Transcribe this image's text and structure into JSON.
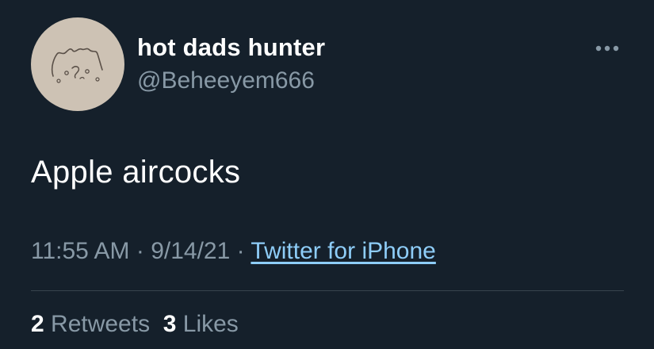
{
  "author": {
    "display_name": "hot dads hunter",
    "handle": "@Beheeyem666",
    "avatar_icon": "doodle-face-avatar"
  },
  "more_icon": "more-horizontal-icon",
  "tweet": {
    "text": "Apple aircocks",
    "time": "11:55 AM",
    "sep1": " · ",
    "date": "9/14/21",
    "sep2": " · ",
    "source": "Twitter for iPhone"
  },
  "stats": {
    "retweets_count": "2",
    "retweets_label": " Retweets",
    "likes_count": "3",
    "likes_label": " Likes"
  },
  "colors": {
    "background": "#15202b",
    "primary_text": "#ffffff",
    "secondary_text": "#8899a6",
    "link": "#8ecdf8",
    "divider": "#38444d",
    "avatar_bg": "#cdc2b4"
  }
}
